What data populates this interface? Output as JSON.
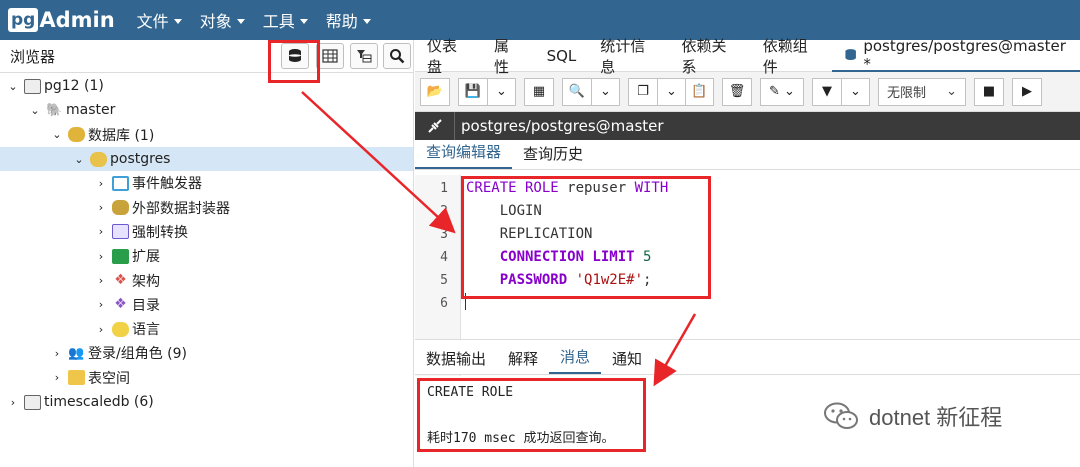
{
  "app": {
    "logo_pg": "pg",
    "logo_admin": "Admin"
  },
  "menu": [
    {
      "label": "文件"
    },
    {
      "label": "对象"
    },
    {
      "label": "工具"
    },
    {
      "label": "帮助"
    }
  ],
  "browser": {
    "title": "浏览器",
    "tree": [
      {
        "label": "pg12 (1)",
        "depth": 0,
        "expand": "down",
        "icon": "server-group-icon"
      },
      {
        "label": "master",
        "depth": 1,
        "expand": "down",
        "icon": "postgres-server-icon"
      },
      {
        "label": "数据库 (1)",
        "depth": 2,
        "expand": "down",
        "icon": "databases-icon"
      },
      {
        "label": "postgres",
        "depth": 3,
        "expand": "down",
        "icon": "database-icon",
        "selected": true
      },
      {
        "label": "事件触发器",
        "depth": 4,
        "expand": "right",
        "icon": "event-trigger-icon"
      },
      {
        "label": "外部数据封装器",
        "depth": 4,
        "expand": "right",
        "icon": "fdw-icon"
      },
      {
        "label": "强制转换",
        "depth": 4,
        "expand": "right",
        "icon": "cast-icon"
      },
      {
        "label": "扩展",
        "depth": 4,
        "expand": "right",
        "icon": "extension-icon"
      },
      {
        "label": "架构",
        "depth": 4,
        "expand": "right",
        "icon": "schema-icon"
      },
      {
        "label": "目录",
        "depth": 4,
        "expand": "right",
        "icon": "catalog-icon"
      },
      {
        "label": "语言",
        "depth": 4,
        "expand": "right",
        "icon": "language-icon"
      },
      {
        "label": "登录/组角色 (9)",
        "depth": 2,
        "expand": "right",
        "icon": "roles-icon"
      },
      {
        "label": "表空间",
        "depth": 2,
        "expand": "right",
        "icon": "tablespace-icon"
      },
      {
        "label": "timescaledb (6)",
        "depth": 0,
        "expand": "right",
        "icon": "server-group-icon"
      }
    ]
  },
  "tabs": [
    {
      "label": "仪表盘"
    },
    {
      "label": "属性"
    },
    {
      "label": "SQL"
    },
    {
      "label": "统计信息"
    },
    {
      "label": "依赖关系"
    },
    {
      "label": "依赖组件"
    },
    {
      "label": "postgres/postgres@master *",
      "active": true
    }
  ],
  "toolbar": {
    "limit_label": "无限制"
  },
  "connection": {
    "label": "postgres/postgres@master"
  },
  "editor_tabs": [
    {
      "label": "查询编辑器",
      "active": true
    },
    {
      "label": "查询历史"
    }
  ],
  "editor": {
    "line_numbers": [
      "1",
      "2",
      "3",
      "4",
      "5",
      "6"
    ],
    "lines": [
      [
        {
          "t": "CREATE ROLE",
          "c": "kw"
        },
        {
          "t": " repuser ",
          "c": "plain"
        },
        {
          "t": "WITH",
          "c": "kw"
        }
      ],
      [
        {
          "t": "    LOGIN",
          "c": "plain"
        }
      ],
      [
        {
          "t": "    REPLICATION",
          "c": "plain"
        }
      ],
      [
        {
          "t": "    CONNECTION LIMIT",
          "c": "kwb"
        },
        {
          "t": " 5",
          "c": "num"
        }
      ],
      [
        {
          "t": "    PASSWORD",
          "c": "kwb"
        },
        {
          "t": " 'Q1w2E#'",
          "c": "str"
        },
        {
          "t": ";",
          "c": "plain"
        }
      ]
    ]
  },
  "result_tabs": [
    {
      "label": "数据输出"
    },
    {
      "label": "解释"
    },
    {
      "label": "消息",
      "active": true
    },
    {
      "label": "通知"
    }
  ],
  "messages": {
    "line1": "CREATE ROLE",
    "line2": "耗时170 msec 成功返回查询。"
  },
  "watermark": {
    "text": "dotnet 新征程"
  },
  "colors": {
    "brand": "#326690",
    "annotation": "#e8262a"
  }
}
